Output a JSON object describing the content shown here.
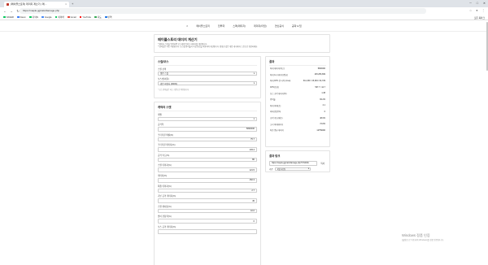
{
  "browser": {
    "tab_title": "[메이플스토리] 데미지 계산기 | 메…",
    "url": "https://maple.gg/calc/damage.php",
    "close_glyph": "×",
    "new_tab_glyph": "+",
    "win_min": "─",
    "win_max": "□",
    "win_close": "✕",
    "back_glyph": "←",
    "forward_glyph": "→",
    "reload_glyph": "↻",
    "bookmarks": [
      {
        "label": "NAVER",
        "color": "#03c75a"
      },
      {
        "label": "Daum",
        "color": "#3478f6"
      },
      {
        "label": "지식iN",
        "color": "#03c75a"
      },
      {
        "label": "Google",
        "color": "#4285f4"
      },
      {
        "label": "네이버",
        "color": "#03c75a"
      },
      {
        "label": "Gmail",
        "color": "#ea4335"
      },
      {
        "label": "YouTube",
        "color": "#ff0000"
      },
      {
        "label": "지도",
        "color": "#34a853"
      },
      {
        "label": "번역",
        "color": "#1a73e8"
      }
    ],
    "all_bookmarks": "모든 북마크"
  },
  "site_nav": {
    "home_glyph": "⌂",
    "items": [
      "메이플스토리",
      "전투력",
      "스펙(데미지)",
      "데미지(타입)",
      "연산공식",
      "공략 & 팁"
    ]
  },
  "intro": {
    "title": "메이플스토리 데미지 계산기",
    "lines": [
      "* 캐릭터 스텟을 입력하면 보스에게 입히는 데미지를 계산합니다.",
      "* 입력값은 자동 저장됩니다. 보스별 방어율과 속성 반감을 적용하여 계산합니다. 정확한 값은 게임 내 데미지 스킨으로 확인하세요."
    ]
  },
  "skill_card": {
    "title": "스킬/보스",
    "skill_label": "스킬 선택",
    "skill_value": "일반 스킬",
    "boss_label": "보스(방어율)",
    "boss_value": "검은 마법사 (300%)",
    "note": "* 보스 방어율은 하드 기준으로 적용됩니다."
  },
  "stat_card": {
    "title": "캐릭터 스탯",
    "fields": [
      {
        "label": "레벨",
        "value": "1"
      },
      {
        "label": "공격력",
        "value": "5830000"
      },
      {
        "label": "크리티컬 확률(%)",
        "value": "75.7"
      },
      {
        "label": "크리티컬 데미지(%)",
        "value": "103.4"
      },
      {
        "label": "공격 속도(%)",
        "value": "80"
      },
      {
        "label": "스킬 데미지(%)",
        "value": "121.5"
      },
      {
        "label": "데미지(%)",
        "value": "152.3"
      },
      {
        "label": "최종 데미지(%)",
        "value": "2.7"
      },
      {
        "label": "기본 공격 데미지(%)",
        "value": "45"
      },
      {
        "label": "스킬 재사용(%)",
        "value": "10.0"
      },
      {
        "label": "방어 관통력(%)",
        "value": "0"
      },
      {
        "label": "보스 공격 데미지(%)",
        "value": ""
      }
    ]
  },
  "result_card": {
    "title": "결과",
    "rows": [
      {
        "k": "최대 데미지(최고)",
        "v": "5830000"
      },
      {
        "k": "최대 1타 데미지(평균)",
        "v": "445,256,669"
      },
      {
        "k": "최대 DPS 전 타격 (Area)",
        "v": "611,330 / 15,349 / 64,729"
      },
      {
        "k": "DPS(초당)",
        "v": "567.7 / 12.7"
      },
      {
        "k": "보스 공격 데미지(%)",
        "v": "1.38"
      },
      {
        "k": "방어율",
        "v": "84.2%"
      },
      {
        "k": "최대 피해(초)",
        "v": "2.1"
      },
      {
        "k": "피해 반감(%)",
        "v": "0"
      },
      {
        "k": "공격 속도(배수)",
        "v": "48.6%"
      },
      {
        "k": "크리 최대데미지",
        "v": "72.8%"
      },
      {
        "k": "최종 평균 데미지",
        "v": "12759000"
      }
    ]
  },
  "share_card": {
    "title": "결과 링크",
    "url_value": "https://maple.gg/calc/damage.php?l=N4IFA",
    "copy_label": "복사",
    "select_label": "기간",
    "select_value": "1일 (기본)"
  },
  "watermark": {
    "title": "Windows 정품 인증",
    "subtitle": "[설정]으로 이동하여 Windows를 정품 인증합니다."
  }
}
